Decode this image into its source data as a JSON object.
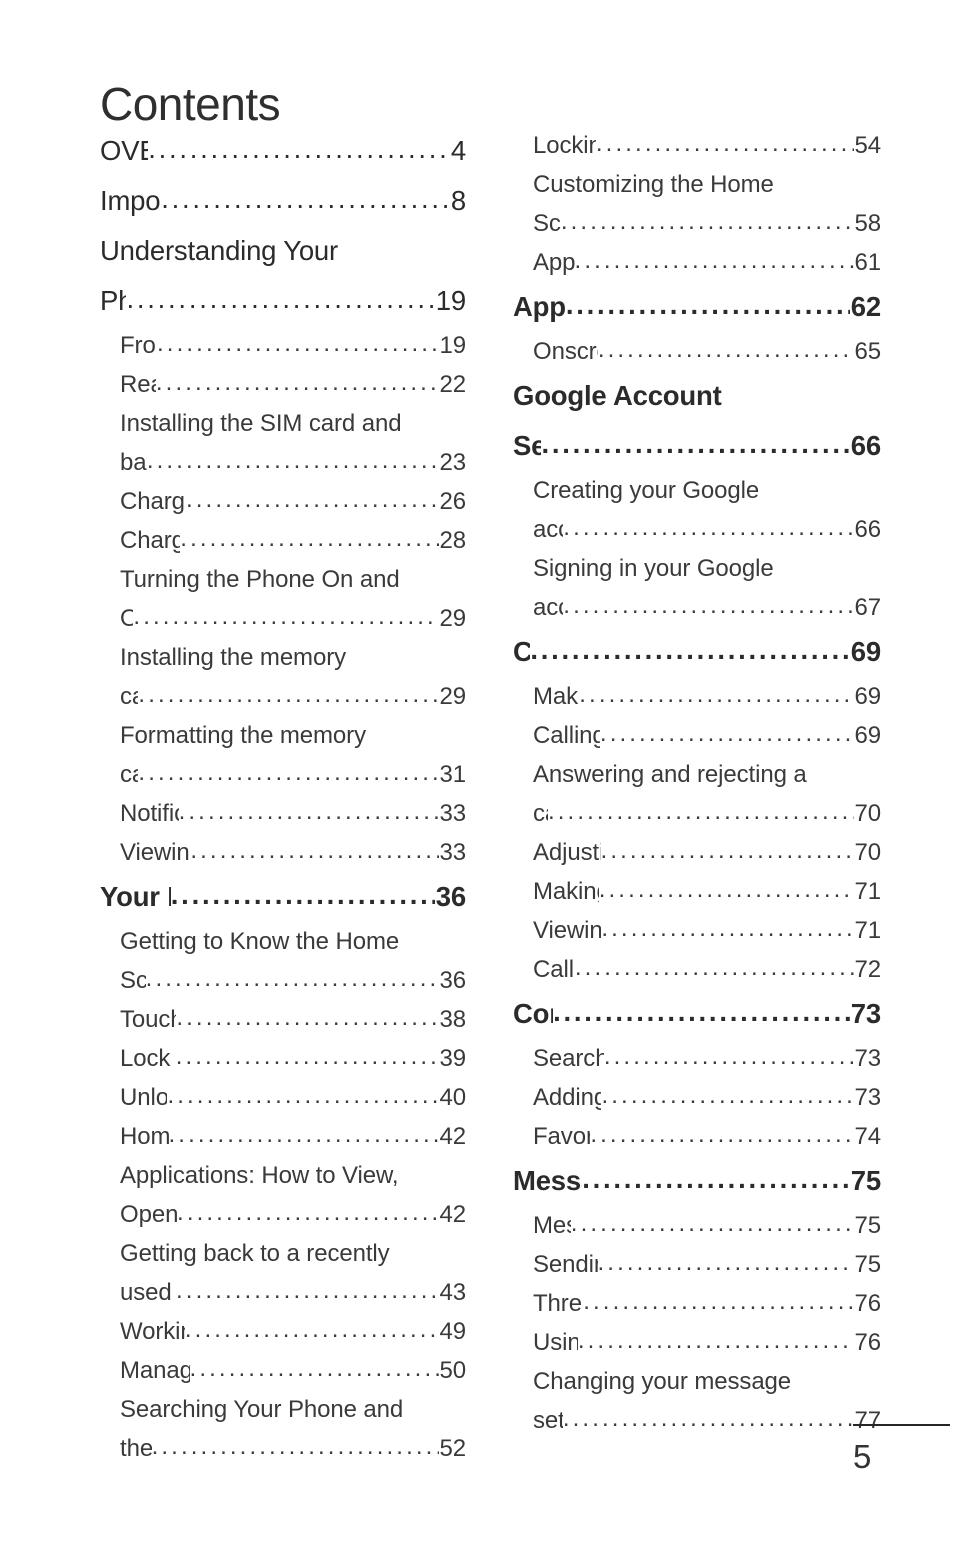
{
  "document": {
    "title": "Contents",
    "page_number": "5"
  },
  "columns": {
    "left": [
      {
        "level": 1,
        "bold": false,
        "lines": [
          "OVERVIEW"
        ],
        "page": "4"
      },
      {
        "level": 1,
        "bold": false,
        "lines": [
          "Important notice"
        ],
        "page": "8"
      },
      {
        "level": 1,
        "bold": false,
        "lines": [
          "Understanding Your",
          "Phone"
        ],
        "page": "19"
      },
      {
        "level": 2,
        "bold": false,
        "lines": [
          "Front View"
        ],
        "page": "19"
      },
      {
        "level": 2,
        "bold": false,
        "lines": [
          "Rear View"
        ],
        "page": "22"
      },
      {
        "level": 2,
        "bold": false,
        "lines": [
          "Installing the SIM card and",
          "battery "
        ],
        "page": "23"
      },
      {
        "level": 2,
        "bold": false,
        "lines": [
          "Charging your Phone"
        ],
        "page": "26"
      },
      {
        "level": 2,
        "bold": false,
        "lines": [
          "Charging with USB"
        ],
        "page": "28"
      },
      {
        "level": 2,
        "bold": false,
        "lines": [
          "Turning the Phone On and",
          "Off "
        ],
        "page": "29"
      },
      {
        "level": 2,
        "bold": false,
        "lines": [
          "Installing the memory",
          "card "
        ],
        "page": "29"
      },
      {
        "level": 2,
        "bold": false,
        "lines": [
          "Formatting the memory",
          "card "
        ],
        "page": "31"
      },
      {
        "level": 2,
        "bold": false,
        "lines": [
          "Notifications panel"
        ],
        "page": "33"
      },
      {
        "level": 2,
        "bold": false,
        "lines": [
          "Viewing the Status bar "
        ],
        "page": "33"
      },
      {
        "level": 1,
        "bold": true,
        "lines": [
          "Your Home screen "
        ],
        "page": "36"
      },
      {
        "level": 2,
        "bold": false,
        "lines": [
          "Getting to Know the Home",
          "Screen"
        ],
        "page": "36"
      },
      {
        "level": 2,
        "bold": false,
        "lines": [
          "Touch screen tips"
        ],
        "page": "38"
      },
      {
        "level": 2,
        "bold": false,
        "lines": [
          "Lock your phone "
        ],
        "page": "39"
      },
      {
        "level": 2,
        "bold": false,
        "lines": [
          "Unlock screen"
        ],
        "page": "40"
      },
      {
        "level": 2,
        "bold": false,
        "lines": [
          "Home screen  "
        ],
        "page": "42"
      },
      {
        "level": 2,
        "bold": false,
        "lines": [
          "Applications: How to View,",
          "Open and Switch "
        ],
        "page": "42"
      },
      {
        "level": 2,
        "bold": false,
        "lines": [
          "Getting back to a recently",
          "used applications"
        ],
        "page": "43"
      },
      {
        "level": 2,
        "bold": false,
        "lines": [
          "Working with Menus "
        ],
        "page": "49"
      },
      {
        "level": 2,
        "bold": false,
        "lines": [
          "Managing Notifications"
        ],
        "page": "50"
      },
      {
        "level": 2,
        "bold": false,
        "lines": [
          "Searching Your Phone and",
          "the Web "
        ],
        "page": "52"
      }
    ],
    "right": [
      {
        "level": 2,
        "bold": false,
        "lines": [
          "Locking the Screen "
        ],
        "page": "54"
      },
      {
        "level": 2,
        "bold": false,
        "lines": [
          "Customizing the Home",
          "Screen "
        ],
        "page": "58"
      },
      {
        "level": 2,
        "bold": false,
        "lines": [
          "Applications"
        ],
        "page": "61"
      },
      {
        "level": 1,
        "bold": true,
        "lines": [
          "Applications "
        ],
        "page": "62"
      },
      {
        "level": 2,
        "bold": false,
        "lines": [
          "Onscreen Keyboard "
        ],
        "page": "65"
      },
      {
        "level": 1,
        "bold": true,
        "lines": [
          "Google Account",
          "Set-up"
        ],
        "page": "66"
      },
      {
        "level": 2,
        "bold": false,
        "lines": [
          "Creating your Google",
          "account "
        ],
        "page": "66"
      },
      {
        "level": 2,
        "bold": false,
        "lines": [
          "Signing in your Google",
          "account "
        ],
        "page": "67"
      },
      {
        "level": 1,
        "bold": true,
        "lines": [
          "Call"
        ],
        "page": "69"
      },
      {
        "level": 2,
        "bold": false,
        "lines": [
          "Making a call "
        ],
        "page": "69"
      },
      {
        "level": 2,
        "bold": false,
        "lines": [
          "Calling your contacts "
        ],
        "page": "69"
      },
      {
        "level": 2,
        "bold": false,
        "lines": [
          "Answering and rejecting a",
          "call "
        ],
        "page": "70"
      },
      {
        "level": 2,
        "bold": false,
        "lines": [
          "Adjusting call volume "
        ],
        "page": "70"
      },
      {
        "level": 2,
        "bold": false,
        "lines": [
          "Making a second call"
        ],
        "page": "71"
      },
      {
        "level": 2,
        "bold": false,
        "lines": [
          "Viewing your Call logs"
        ],
        "page": "71"
      },
      {
        "level": 2,
        "bold": false,
        "lines": [
          "Call settings"
        ],
        "page": "72"
      },
      {
        "level": 1,
        "bold": true,
        "lines": [
          "Contacts "
        ],
        "page": "73"
      },
      {
        "level": 2,
        "bold": false,
        "lines": [
          "Searching for a contact"
        ],
        "page": "73"
      },
      {
        "level": 2,
        "bold": false,
        "lines": [
          "Adding a new contact "
        ],
        "page": "73"
      },
      {
        "level": 2,
        "bold": false,
        "lines": [
          "Favorite contacts "
        ],
        "page": "74"
      },
      {
        "level": 1,
        "bold": true,
        "lines": [
          "Messaging/E-mail "
        ],
        "page": "75"
      },
      {
        "level": 2,
        "bold": false,
        "lines": [
          "Messaging"
        ],
        "page": "75"
      },
      {
        "level": 2,
        "bold": false,
        "lines": [
          "Sending a message "
        ],
        "page": "75"
      },
      {
        "level": 2,
        "bold": false,
        "lines": [
          "Threaded box  "
        ],
        "page": "76"
      },
      {
        "level": 2,
        "bold": false,
        "lines": [
          "Using smilies"
        ],
        "page": "76"
      },
      {
        "level": 2,
        "bold": false,
        "lines": [
          "Changing your message",
          "settings "
        ],
        "page": "77"
      }
    ]
  }
}
